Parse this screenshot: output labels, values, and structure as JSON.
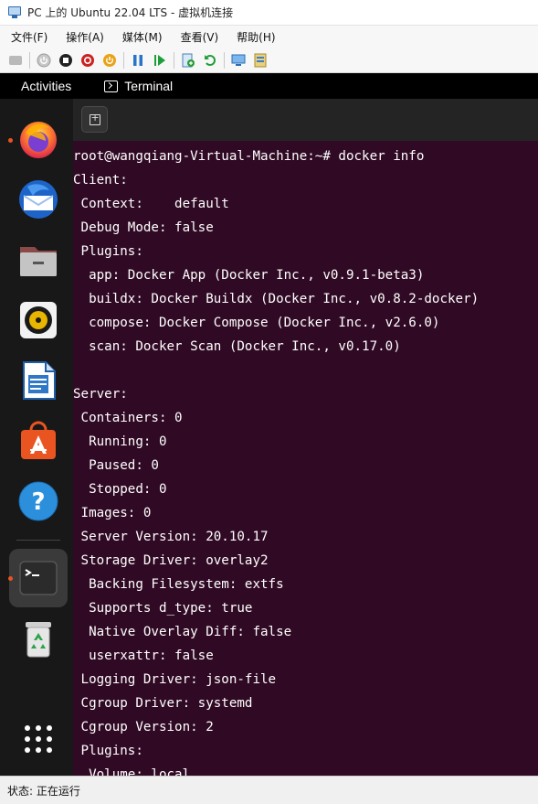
{
  "window": {
    "title": "PC 上的 Ubuntu 22.04 LTS - 虚拟机连接"
  },
  "menubar": {
    "items": [
      "文件(F)",
      "操作(A)",
      "媒体(M)",
      "查看(V)",
      "帮助(H)"
    ]
  },
  "toolbar": {
    "buttons": [
      "ctrl-alt-del-icon",
      "start-icon",
      "turn-off-icon",
      "shutdown-icon",
      "save-icon",
      "pause-icon",
      "reset-icon",
      "checkpoint-icon",
      "revert-icon",
      "enhanced-session-icon",
      "share-icon"
    ]
  },
  "topbar": {
    "activities": "Activities",
    "app_name": "Terminal"
  },
  "dock": {
    "apps": [
      "Firefox",
      "Thunderbird",
      "Files",
      "Rhythmbox",
      "LibreOffice Writer",
      "Ubuntu Software",
      "Help",
      "Terminal",
      "Trash",
      "Show Applications"
    ],
    "running": [
      "Firefox",
      "Terminal"
    ]
  },
  "terminal": {
    "lines": [
      "root@wangqiang-Virtual-Machine:~# docker info",
      "Client:",
      " Context:    default",
      " Debug Mode: false",
      " Plugins:",
      "  app: Docker App (Docker Inc., v0.9.1-beta3)",
      "  buildx: Docker Buildx (Docker Inc., v0.8.2-docker)",
      "  compose: Docker Compose (Docker Inc., v2.6.0)",
      "  scan: Docker Scan (Docker Inc., v0.17.0)",
      "",
      "Server:",
      " Containers: 0",
      "  Running: 0",
      "  Paused: 0",
      "  Stopped: 0",
      " Images: 0",
      " Server Version: 20.10.17",
      " Storage Driver: overlay2",
      "  Backing Filesystem: extfs",
      "  Supports d_type: true",
      "  Native Overlay Diff: false",
      "  userxattr: false",
      " Logging Driver: json-file",
      " Cgroup Driver: systemd",
      " Cgroup Version: 2",
      " Plugins:",
      "  Volume: local"
    ]
  },
  "statusbar": {
    "text": "状态: 正在运行"
  },
  "colors": {
    "terminal_bg": "#300a24",
    "dock_bg": "#181818",
    "topbar_bg": "#000000",
    "accent": "#e95420"
  }
}
